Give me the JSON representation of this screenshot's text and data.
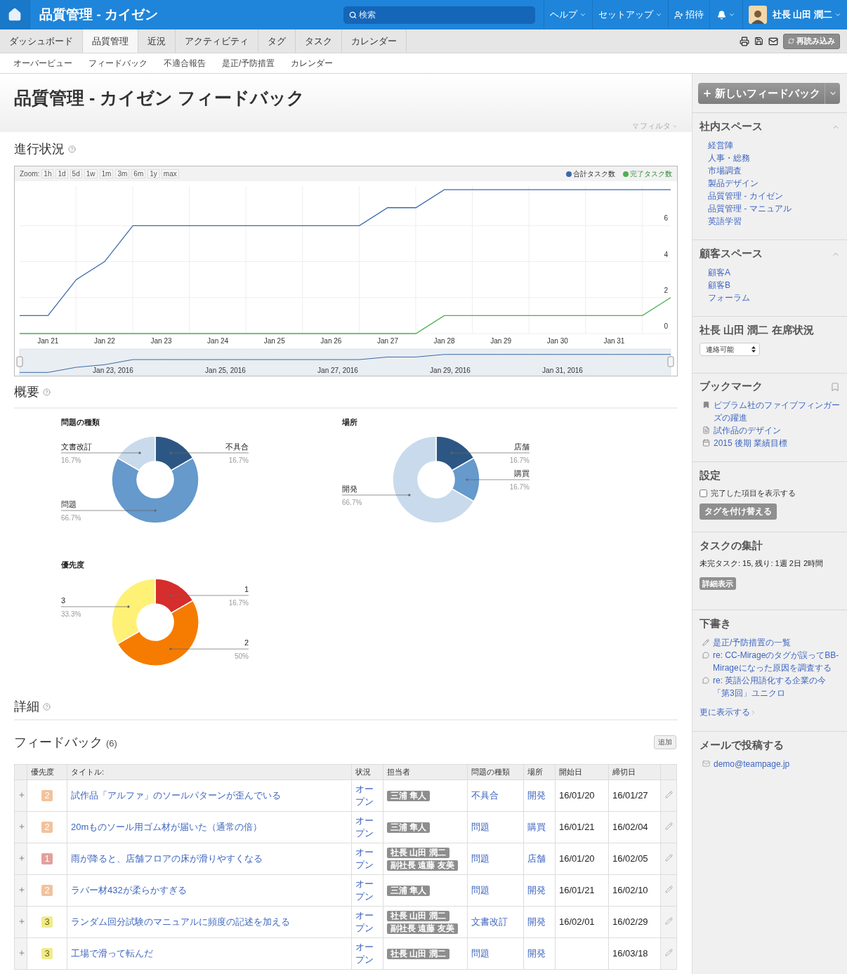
{
  "header": {
    "title": "品質管理 - カイゼン",
    "search": {
      "placeholder": "検索"
    },
    "menus": [
      "ヘルプ",
      "セットアップ"
    ],
    "invite": "招待",
    "user": "社長 山田 潤二"
  },
  "tabs": [
    {
      "label": "ダッシュボード",
      "selected": false
    },
    {
      "label": "品質管理",
      "selected": true
    },
    {
      "label": "近況",
      "selected": false
    },
    {
      "label": "アクティビティ",
      "selected": false
    },
    {
      "label": "タグ",
      "selected": false
    },
    {
      "label": "タスク",
      "selected": false
    },
    {
      "label": "カレンダー",
      "selected": false
    }
  ],
  "reload_button": "再読み込み",
  "subnav": [
    "オーバービュー",
    "フィードバック",
    "不適合報告",
    "是正/予防措置",
    "カレンダー"
  ],
  "page_title": "品質管理 - カイゼン フィードバック",
  "filter": "フィルタ",
  "progress": {
    "heading": "進行状況",
    "zoom_label": "Zoom:",
    "zoom_buttons": [
      "1h",
      "1d",
      "5d",
      "1w",
      "1m",
      "3m",
      "6m",
      "1y",
      "max"
    ],
    "navigator_labels": [
      "Jan 23, 2016",
      "Jan 25, 2016",
      "Jan 27, 2016",
      "Jan 29, 2016",
      "Jan 31, 2016"
    ],
    "chart_data": {
      "type": "line",
      "categories": [
        null,
        "Jan 21",
        null,
        "Jan 22",
        null,
        "Jan 23",
        null,
        "Jan 24",
        null,
        "Jan 25",
        null,
        "Jan 26",
        null,
        "Jan 27",
        null,
        "Jan 28",
        null,
        "Jan 29",
        null,
        "Jan 30",
        null,
        "Jan 31",
        null,
        null
      ],
      "series": [
        {
          "name": "合計タスク数",
          "color": "#3a6aa8",
          "values": [
            1,
            1,
            3,
            4,
            6,
            6,
            6,
            6,
            6,
            6,
            6,
            6,
            6,
            7,
            7,
            8,
            8,
            8,
            8,
            8,
            8,
            8,
            8,
            8
          ]
        },
        {
          "name": "完了タスク数",
          "color": "#4caf50",
          "values": [
            0,
            0,
            0,
            0,
            0,
            0,
            0,
            0,
            0,
            0,
            0,
            0,
            0,
            0,
            0,
            1,
            1,
            1,
            1,
            1,
            1,
            1,
            1,
            2
          ]
        }
      ],
      "ylim": [
        0,
        8.2
      ],
      "yticks": [
        0,
        2,
        4,
        6
      ],
      "grid": true
    }
  },
  "overview": {
    "heading": "概要",
    "charts": [
      {
        "chart_data": {
          "type": "donut",
          "title": "問題の種類",
          "categories": [
            "不具合",
            "問題",
            "文書改訂"
          ],
          "values": [
            16.7,
            66.7,
            16.7
          ],
          "colors": [
            "#2c5784",
            "#6699cc",
            "#c9daec"
          ],
          "value_labels": [
            "16.7%",
            "66.7%",
            "16.7%"
          ]
        }
      },
      {
        "chart_data": {
          "type": "donut",
          "title": "場所",
          "categories": [
            "店舗",
            "購買",
            "開発"
          ],
          "values": [
            16.7,
            16.7,
            66.7
          ],
          "colors": [
            "#2c5784",
            "#6699cc",
            "#c9daec"
          ],
          "value_labels": [
            "16.7%",
            "16.7%",
            "66.7%"
          ]
        }
      },
      {
        "chart_data": {
          "type": "donut",
          "title": "優先度",
          "categories": [
            "1",
            "2",
            "3"
          ],
          "values": [
            16.7,
            50,
            33.3
          ],
          "colors": [
            "#d62d2d",
            "#f57c00",
            "#fff176"
          ],
          "value_labels": [
            "16.7%",
            "50%",
            "33.3%"
          ]
        }
      }
    ]
  },
  "details": {
    "heading": "詳細",
    "list_title": "フィードバック",
    "count": "(6)",
    "add_button": "追加",
    "columns": [
      "優先度",
      "タイトル:",
      "状況",
      "担当者",
      "問題の種類",
      "場所",
      "開始日",
      "締切日"
    ],
    "rows": [
      {
        "priority": "2",
        "color": "#f2c29c",
        "title": "試作品「アルファ」のソールパターンが歪んでいる",
        "status": "オープン",
        "assignees": [
          "三浦 隼人"
        ],
        "type": "不具合",
        "place": "開発",
        "start": "16/01/20",
        "due": "16/01/27"
      },
      {
        "priority": "2",
        "color": "#f2c29c",
        "title": "20mものソール用ゴム材が届いた（通常の倍）",
        "status": "オープン",
        "assignees": [
          "三浦 隼人"
        ],
        "type": "問題",
        "place": "購買",
        "start": "16/01/21",
        "due": "16/02/04"
      },
      {
        "priority": "1",
        "color": "#e3a09c",
        "title": "雨が降ると、店舗フロアの床が滑りやすくなる",
        "status": "オープン",
        "assignees": [
          "社長 山田 潤二",
          "副社長 遠藤 友美"
        ],
        "type": "問題",
        "place": "店舗",
        "start": "16/01/20",
        "due": "16/02/05"
      },
      {
        "priority": "2",
        "color": "#f2c29c",
        "title": "ラバー材432が柔らかすぎる",
        "status": "オープン",
        "assignees": [
          "三浦 隼人"
        ],
        "type": "問題",
        "place": "開発",
        "start": "16/01/21",
        "due": "16/02/10"
      },
      {
        "priority": "3",
        "color": "#f0ec8c",
        "title": "ランダム回分試験のマニュアルに頻度の記述を加える",
        "status": "オープン",
        "assignees": [
          "社長 山田 潤二",
          "副社長 遠藤 友美"
        ],
        "type": "文書改訂",
        "place": "開発",
        "start": "16/02/01",
        "due": "16/02/29"
      },
      {
        "priority": "3",
        "color": "#f0ec8c",
        "title": "工場で滑って転んだ",
        "status": "オープン",
        "assignees": [
          "社長 山田 潤二"
        ],
        "type": "問題",
        "place": "開発",
        "due": "16/03/18"
      }
    ]
  },
  "sidebar": {
    "new_button": "新しいフィードバック",
    "spaces": [
      {
        "title": "社内スペース",
        "expanded": true,
        "items": [
          "経営陣",
          "人事・総務",
          "市場調査",
          "製品デザイン",
          "品質管理 - カイゼン",
          "品質管理 - マニュアル",
          "英語学習"
        ]
      },
      {
        "title": "顧客スペース",
        "expanded": true,
        "items": [
          "顧客A",
          "顧客B",
          "フォーラム"
        ]
      }
    ],
    "presence": {
      "title": "社長 山田 潤二 在席状況",
      "value": "連絡可能"
    },
    "bookmarks": {
      "title": "ブックマーク",
      "items": [
        {
          "kind": "bookmark",
          "text": "ビブラム社のファイブフィンガーズの躍進"
        },
        {
          "kind": "document",
          "text": "試作品のデザイン"
        },
        {
          "kind": "calendar",
          "text": "2015 後期 業績目標"
        }
      ]
    },
    "settings": {
      "title": "設定",
      "checkbox": {
        "label": "完了した項目を表示する",
        "checked": false
      },
      "button": "タグを付け替える"
    },
    "tasks": {
      "title": "タスクの集計",
      "summary": "未完タスク: 15, 残り: 1週 2日 2時間",
      "button": "詳細表示"
    },
    "drafts": {
      "title": "下書き",
      "items": [
        {
          "kind": "edit",
          "text": "是正/予防措置の一覧"
        },
        {
          "kind": "comment",
          "text": "re: CC-Mirageのタグが誤ってBB-Mirageになった原因を調査する"
        },
        {
          "kind": "comment",
          "text": "re: 英語公用語化する企業の今「第3回」ユニクロ"
        }
      ],
      "more": "更に表示する"
    },
    "mail": {
      "title": "メールで投稿する",
      "address": "demo@teampage.jp"
    }
  }
}
